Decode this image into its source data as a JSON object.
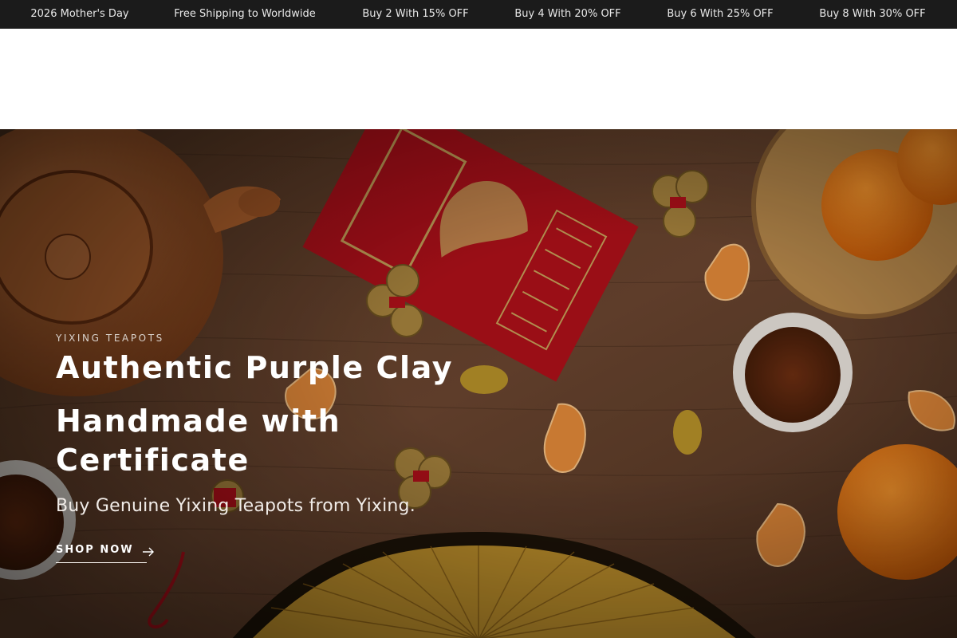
{
  "announcement_bar": {
    "messages": [
      "2026 Mother's Day",
      "Free Shipping to Worldwide",
      "Buy 2 With 15% OFF",
      "Buy 4 With 20% OFF",
      "Buy 6 With 25% OFF",
      "Buy 8 With 30% OFF"
    ],
    "background": "#1b1b1b",
    "text_color": "#e8e8e8"
  },
  "hero": {
    "eyebrow": "YIXING TEAPOTS",
    "headline_line1": "Authentic Purple Clay",
    "headline_line2": "Handmade with Certificate",
    "subheading": "Buy Genuine Yixing Teapots from Yixing.",
    "cta_label": "SHOP NOW",
    "cta_icon": "arrow-right-icon",
    "background_image": "teapot-table-scene",
    "text_color": "#ffffff"
  }
}
